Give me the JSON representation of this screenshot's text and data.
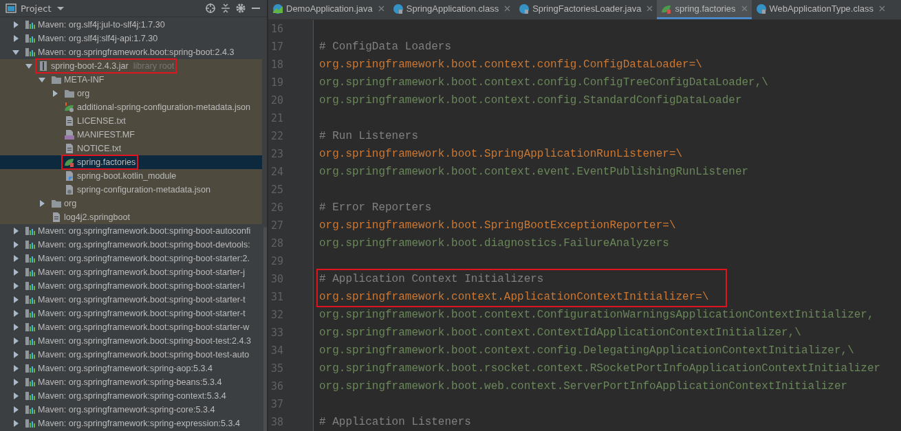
{
  "project_panel": {
    "title": "Project",
    "tree": [
      {
        "label": "Maven: org.slf4j:jul-to-slf4j:1.7.30",
        "kind": "library",
        "expanded": false,
        "selected": false,
        "boxed": false
      },
      {
        "label": "Maven: org.slf4j:slf4j-api:1.7.30",
        "kind": "library",
        "expanded": false,
        "selected": false,
        "boxed": false
      },
      {
        "label": "Maven: org.springframework.boot:spring-boot:2.4.3",
        "kind": "library",
        "expanded": true,
        "selected": false,
        "boxed": false,
        "children": [
          {
            "label": "spring-boot-2.4.3.jar",
            "suffix": "library root",
            "kind": "jar",
            "expanded": true,
            "selected": false,
            "boxed": true,
            "children": [
              {
                "label": "META-INF",
                "kind": "folder",
                "expanded": true,
                "selected": false,
                "boxed": false,
                "children": [
                  {
                    "label": "org",
                    "kind": "folder",
                    "expanded": false,
                    "selected": false,
                    "boxed": false
                  },
                  {
                    "label": "additional-spring-configuration-metadata.json",
                    "kind": "spring-json-file",
                    "selected": false,
                    "boxed": false
                  },
                  {
                    "label": "LICENSE.txt",
                    "kind": "text-file",
                    "selected": false,
                    "boxed": false
                  },
                  {
                    "label": "MANIFEST.MF",
                    "kind": "manifest-file",
                    "selected": false,
                    "boxed": false
                  },
                  {
                    "label": "NOTICE.txt",
                    "kind": "text-file",
                    "selected": false,
                    "boxed": false
                  },
                  {
                    "label": "spring.factories",
                    "kind": "spring-file",
                    "selected": true,
                    "boxed": true
                  },
                  {
                    "label": "spring-boot.kotlin_module",
                    "kind": "kotlin-file",
                    "selected": false,
                    "boxed": false
                  },
                  {
                    "label": "spring-configuration-metadata.json",
                    "kind": "json-file",
                    "selected": false,
                    "boxed": false
                  }
                ]
              },
              {
                "label": "org",
                "kind": "folder",
                "expanded": false,
                "selected": false,
                "boxed": false
              },
              {
                "label": "log4j2.springboot",
                "kind": "text-file",
                "selected": false,
                "boxed": false
              }
            ]
          }
        ]
      },
      {
        "label": "Maven: org.springframework.boot:spring-boot-autoconfi",
        "kind": "library",
        "expanded": false,
        "selected": false,
        "boxed": false
      },
      {
        "label": "Maven: org.springframework.boot:spring-boot-devtools:",
        "kind": "library",
        "expanded": false,
        "selected": false,
        "boxed": false
      },
      {
        "label": "Maven: org.springframework.boot:spring-boot-starter:2.",
        "kind": "library",
        "expanded": false,
        "selected": false,
        "boxed": false
      },
      {
        "label": "Maven: org.springframework.boot:spring-boot-starter-j",
        "kind": "library",
        "expanded": false,
        "selected": false,
        "boxed": false
      },
      {
        "label": "Maven: org.springframework.boot:spring-boot-starter-l",
        "kind": "library",
        "expanded": false,
        "selected": false,
        "boxed": false
      },
      {
        "label": "Maven: org.springframework.boot:spring-boot-starter-t",
        "kind": "library",
        "expanded": false,
        "selected": false,
        "boxed": false
      },
      {
        "label": "Maven: org.springframework.boot:spring-boot-starter-t",
        "kind": "library",
        "expanded": false,
        "selected": false,
        "boxed": false
      },
      {
        "label": "Maven: org.springframework.boot:spring-boot-starter-w",
        "kind": "library",
        "expanded": false,
        "selected": false,
        "boxed": false
      },
      {
        "label": "Maven: org.springframework.boot:spring-boot-test:2.4.3",
        "kind": "library",
        "expanded": false,
        "selected": false,
        "boxed": false
      },
      {
        "label": "Maven: org.springframework.boot:spring-boot-test-auto",
        "kind": "library",
        "expanded": false,
        "selected": false,
        "boxed": false
      },
      {
        "label": "Maven: org.springframework:spring-aop:5.3.4",
        "kind": "library",
        "expanded": false,
        "selected": false,
        "boxed": false
      },
      {
        "label": "Maven: org.springframework:spring-beans:5.3.4",
        "kind": "library",
        "expanded": false,
        "selected": false,
        "boxed": false
      },
      {
        "label": "Maven: org.springframework:spring-context:5.3.4",
        "kind": "library",
        "expanded": false,
        "selected": false,
        "boxed": false
      },
      {
        "label": "Maven: org.springframework:spring-core:5.3.4",
        "kind": "library",
        "expanded": false,
        "selected": false,
        "boxed": false
      },
      {
        "label": "Maven: org.springframework:spring-expression:5.3.4",
        "kind": "library",
        "expanded": false,
        "selected": false,
        "boxed": false
      }
    ]
  },
  "editor_tabs": [
    {
      "label": "DemoApplication.java",
      "kind": "java-class",
      "selected": false
    },
    {
      "label": "SpringApplication.class",
      "kind": "class-file",
      "selected": false
    },
    {
      "label": "SpringFactoriesLoader.java",
      "kind": "class-file",
      "selected": false
    },
    {
      "label": "spring.factories",
      "kind": "spring-file",
      "selected": true
    },
    {
      "label": "WebApplicationType.class",
      "kind": "enum-file",
      "selected": false
    }
  ],
  "code_lines": [
    {
      "number": "16",
      "kind": "blank",
      "boxed": false
    },
    {
      "number": "17",
      "text": "# ConfigData Loaders",
      "kind": "comment",
      "boxed": false
    },
    {
      "number": "18",
      "text": "org.springframework.boot.context.config.ConfigDataLoader=\\",
      "kind": "key",
      "boxed": false
    },
    {
      "number": "19",
      "text": "org.springframework.boot.context.config.ConfigTreeConfigDataLoader,\\",
      "kind": "value",
      "boxed": false
    },
    {
      "number": "20",
      "text": "org.springframework.boot.context.config.StandardConfigDataLoader",
      "kind": "value",
      "boxed": false
    },
    {
      "number": "21",
      "kind": "blank",
      "boxed": false
    },
    {
      "number": "22",
      "text": "# Run Listeners",
      "kind": "comment",
      "boxed": false
    },
    {
      "number": "23",
      "text": "org.springframework.boot.SpringApplicationRunListener=\\",
      "kind": "key",
      "boxed": false
    },
    {
      "number": "24",
      "text": "org.springframework.boot.context.event.EventPublishingRunListener",
      "kind": "value",
      "boxed": false
    },
    {
      "number": "25",
      "kind": "blank",
      "boxed": false
    },
    {
      "number": "26",
      "text": "# Error Reporters",
      "kind": "comment",
      "boxed": false
    },
    {
      "number": "27",
      "text": "org.springframework.boot.SpringBootExceptionReporter=\\",
      "kind": "key",
      "boxed": false
    },
    {
      "number": "28",
      "text": "org.springframework.boot.diagnostics.FailureAnalyzers",
      "kind": "value",
      "boxed": false
    },
    {
      "number": "29",
      "kind": "blank",
      "boxed": false
    },
    {
      "number": "30",
      "text": "# Application Context Initializers",
      "kind": "comment",
      "boxed": true
    },
    {
      "number": "31",
      "text": "org.springframework.context.ApplicationContextInitializer=\\",
      "kind": "key",
      "boxed": true
    },
    {
      "number": "32",
      "text": "org.springframework.boot.context.ConfigurationWarningsApplicationContextInitializer,",
      "kind": "value",
      "boxed": false
    },
    {
      "number": "33",
      "text": "org.springframework.boot.context.ContextIdApplicationContextInitializer,\\",
      "kind": "value",
      "boxed": false
    },
    {
      "number": "34",
      "text": "org.springframework.boot.context.config.DelegatingApplicationContextInitializer,\\",
      "kind": "value",
      "boxed": false
    },
    {
      "number": "35",
      "text": "org.springframework.boot.rsocket.context.RSocketPortInfoApplicationContextInitializer",
      "kind": "value",
      "boxed": false
    },
    {
      "number": "36",
      "text": "org.springframework.boot.web.context.ServerPortInfoApplicationContextInitializer",
      "kind": "value",
      "boxed": false
    },
    {
      "number": "37",
      "kind": "blank",
      "boxed": false
    },
    {
      "number": "38",
      "text": "# Application Listeners",
      "kind": "comment",
      "boxed": false
    }
  ]
}
